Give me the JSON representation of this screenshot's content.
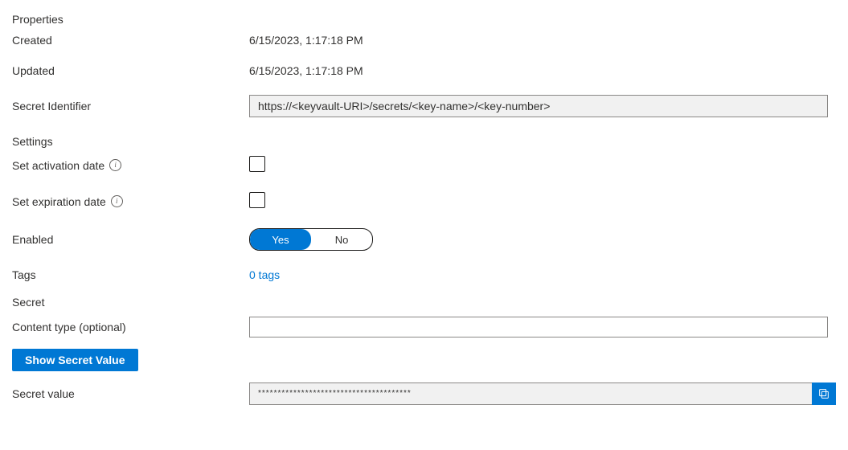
{
  "sections": {
    "properties_header": "Properties",
    "settings_header": "Settings",
    "secret_header": "Secret"
  },
  "fields": {
    "created_label": "Created",
    "created_value": "6/15/2023, 1:17:18 PM",
    "updated_label": "Updated",
    "updated_value": "6/15/2023, 1:17:18 PM",
    "secret_identifier_label": "Secret Identifier",
    "secret_identifier_value": "https://<keyvault-URI>/secrets/<key-name>/<key-number>",
    "activation_label": "Set activation date",
    "expiration_label": "Set expiration date",
    "enabled_label": "Enabled",
    "enabled_yes": "Yes",
    "enabled_no": "No",
    "enabled_value": true,
    "tags_label": "Tags",
    "tags_link": "0 tags",
    "content_type_label": "Content type (optional)",
    "content_type_value": "",
    "show_secret_button": "Show Secret Value",
    "secret_value_label": "Secret value",
    "secret_value_masked": "***************************************"
  }
}
